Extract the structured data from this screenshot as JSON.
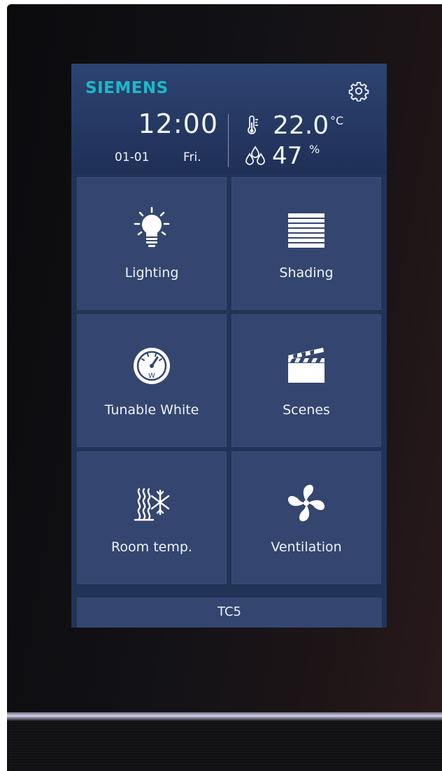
{
  "brand": "SIEMENS",
  "status": {
    "time": "12:00",
    "date": "01-01",
    "weekday": "Fri.",
    "temperature": "22.0",
    "temperature_unit": "°C",
    "humidity": "47",
    "humidity_unit": "%"
  },
  "tiles": [
    {
      "label": "Lighting",
      "icon": "light-bulb-icon"
    },
    {
      "label": "Shading",
      "icon": "blinds-icon"
    },
    {
      "label": "Tunable White",
      "icon": "gauge-icon"
    },
    {
      "label": "Scenes",
      "icon": "clapperboard-icon"
    },
    {
      "label": "Room temp.",
      "icon": "heat-snowflake-icon"
    },
    {
      "label": "Ventilation",
      "icon": "fan-icon"
    }
  ],
  "footer": {
    "label": "TC5"
  },
  "colors": {
    "brand": "#1db9c8",
    "screen_bg": "#223358",
    "tile_bg": "#34466f",
    "text": "#f2f4f8"
  }
}
